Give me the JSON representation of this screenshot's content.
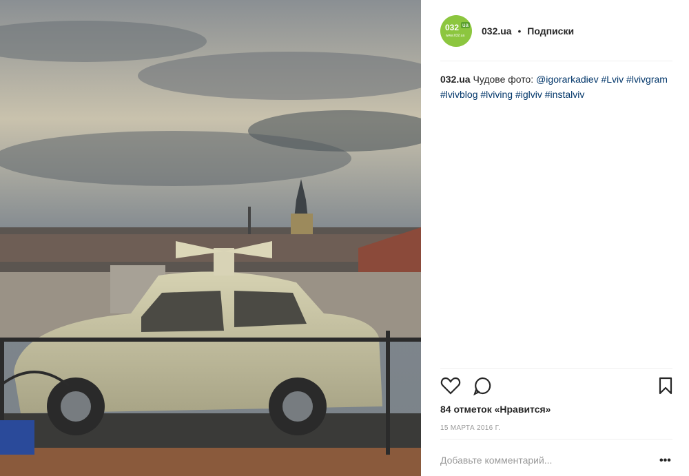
{
  "post": {
    "username": "032.ua",
    "separator": "•",
    "follow_label": "Подписки",
    "avatar": {
      "number": "032",
      "suffix": "ua",
      "site": "www.032.ua"
    },
    "caption": {
      "username": "032.ua",
      "text": "Чудове фото:",
      "mention": "@igorarkadiev",
      "hashtags": [
        "#Lviv",
        "#lvivgram",
        "#lvivblog",
        "#lviving",
        "#iglviv",
        "#instalviv"
      ]
    },
    "likes": "84 отметок «Нравится»",
    "date": "15 МАРТА 2016 Г.",
    "comment_placeholder": "Добавьте комментарий...",
    "more_label": "•••"
  },
  "icons": {
    "like": "heart-icon",
    "comment": "comment-icon",
    "save": "bookmark-icon"
  },
  "colors": {
    "link": "#003569",
    "avatar": "#8cc63f",
    "muted": "#999999"
  }
}
